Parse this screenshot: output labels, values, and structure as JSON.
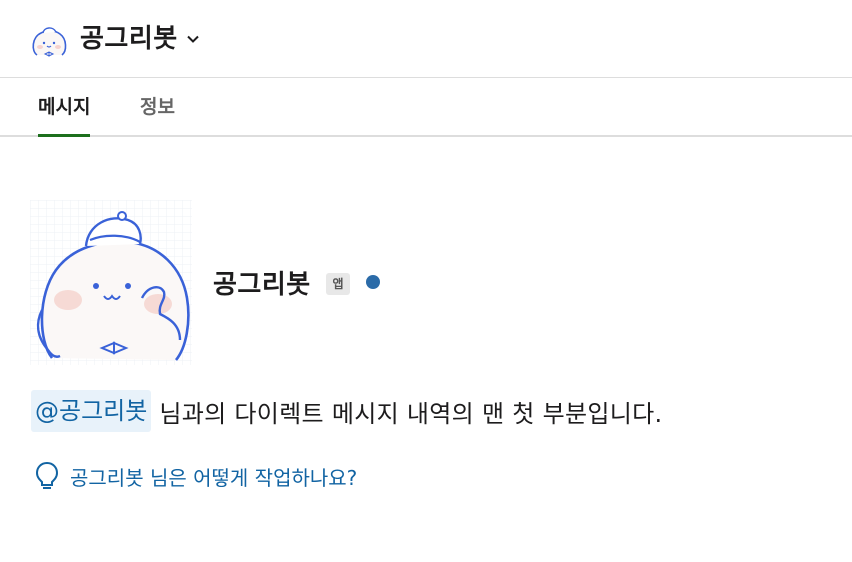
{
  "header": {
    "title": "공그리봇"
  },
  "tabs": [
    {
      "label": "메시지",
      "active": true
    },
    {
      "label": "정보",
      "active": false
    }
  ],
  "profile": {
    "name": "공그리봇",
    "badge": "앱",
    "presence_color": "#2b6ba8"
  },
  "intro": {
    "mention": "@공그리봇",
    "text": "님과의 다이렉트 메시지 내역의 맨 첫 부분입니다."
  },
  "help_link": {
    "label": "공그리봇 님은 어떻게 작업하나요?",
    "icon": "lightbulb-icon"
  },
  "colors": {
    "accent": "#1264a3",
    "tab_underline": "#1d6f1d",
    "mention_bg": "#e8f2fa"
  }
}
